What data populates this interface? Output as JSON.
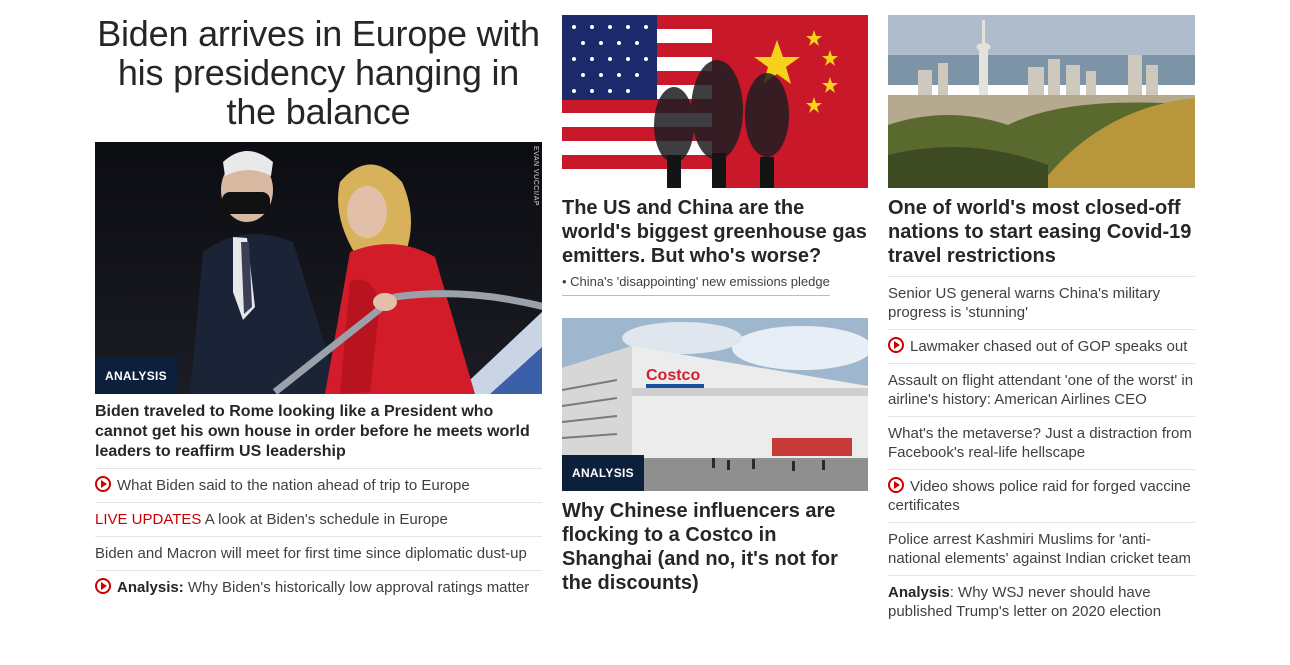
{
  "hero": {
    "headline": "Biden arrives in Europe with his presidency hanging in the balance",
    "badge": "ANALYSIS",
    "photo_credit": "EVAN VUCCI/AP",
    "lead": "Biden traveled to Rome looking like a President who cannot get his own house in order before he meets world leaders to reaffirm US leadership",
    "links": [
      {
        "video": true,
        "prefix": "",
        "text": "What Biden said to the nation ahead of trip to Europe"
      },
      {
        "video": false,
        "prefix": "LIVE UPDATES",
        "text": " A look at Biden's schedule in Europe"
      },
      {
        "video": false,
        "prefix": "",
        "text": "Biden and Macron will meet for first time since diplomatic dust-up"
      },
      {
        "video": true,
        "prefix": "Analysis:",
        "text": " Why Biden's historically low approval ratings matter"
      }
    ]
  },
  "story1": {
    "title": "The US and China are the world's biggest greenhouse gas emitters. But who's worse?",
    "sub": "• China's 'disappointing' new emissions pledge"
  },
  "story2": {
    "badge": "ANALYSIS",
    "title": "Why Chinese influencers are flocking to a Costco in Shanghai (and no, it's not for the discounts)",
    "store_sign": "Costco"
  },
  "story3": {
    "title": "One of world's most closed-off nations to start easing Covid-19 travel restrictions",
    "links": [
      {
        "video": false,
        "prefix": "",
        "text": "Senior US general warns China's military progress is 'stunning'"
      },
      {
        "video": true,
        "prefix": "",
        "text": "Lawmaker chased out of GOP speaks out"
      },
      {
        "video": false,
        "prefix": "",
        "text": "Assault on flight attendant 'one of the worst' in airline's history: American Airlines CEO"
      },
      {
        "video": false,
        "prefix": "",
        "text": "What's the metaverse? Just a distraction from Facebook's real-life hellscape"
      },
      {
        "video": true,
        "prefix": "",
        "text": "Video shows police raid for forged vaccine certificates"
      },
      {
        "video": false,
        "prefix": "",
        "text": "Police arrest Kashmiri Muslims for 'anti-national elements' against Indian cricket team"
      },
      {
        "video": false,
        "prefix": "Analysis",
        "text": ": Why WSJ never should have published Trump's letter on 2020 election"
      }
    ]
  },
  "colors": {
    "accent": "#cc0000",
    "badge_bg": "#0c1f3b",
    "text": "#262626",
    "divider": "#e6e6e6"
  }
}
